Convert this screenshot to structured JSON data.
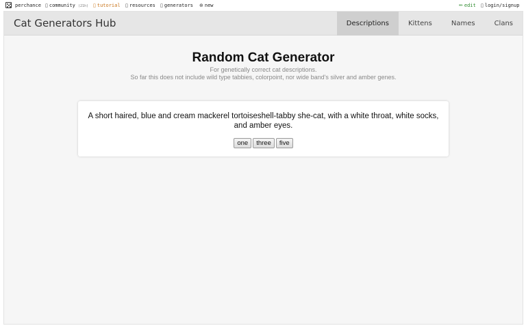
{
  "topbar": {
    "site": "perchance",
    "community": "community",
    "community_count": "(21h)",
    "tutorial": "tutorial",
    "resources": "resources",
    "generators": "generators",
    "new": "new",
    "edit": "edit",
    "login": "login/signup"
  },
  "hub": {
    "title": "Cat Generators Hub",
    "tabs": [
      {
        "label": "Descriptions",
        "active": true
      },
      {
        "label": "Kittens",
        "active": false
      },
      {
        "label": "Names",
        "active": false
      },
      {
        "label": "Clans",
        "active": false
      }
    ]
  },
  "main": {
    "title": "Random Cat Generator",
    "subtitle_1": "For genetically correct cat descriptions.",
    "subtitle_2": "So far this does not include wild type tabbies, colorpoint, nor wide band's silver and amber genes.",
    "output": "A short haired, blue and cream mackerel tortoiseshell-tabby she-cat, with a white throat, white socks, and amber eyes.",
    "buttons": [
      "one",
      "three",
      "five"
    ]
  },
  "colors": {
    "tutorial": "#c8741a",
    "edit": "#2e8b2e",
    "active_tab": "#cfcfcf",
    "header_bg": "#e6e6e6"
  },
  "icons": {
    "site": "dice-icon",
    "community": "chat-icon",
    "tutorial": "book-icon",
    "resources": "resources-icon",
    "generators": "generators-icon",
    "new": "plus-circle-icon",
    "edit": "pencil-icon",
    "login": "user-icon"
  }
}
